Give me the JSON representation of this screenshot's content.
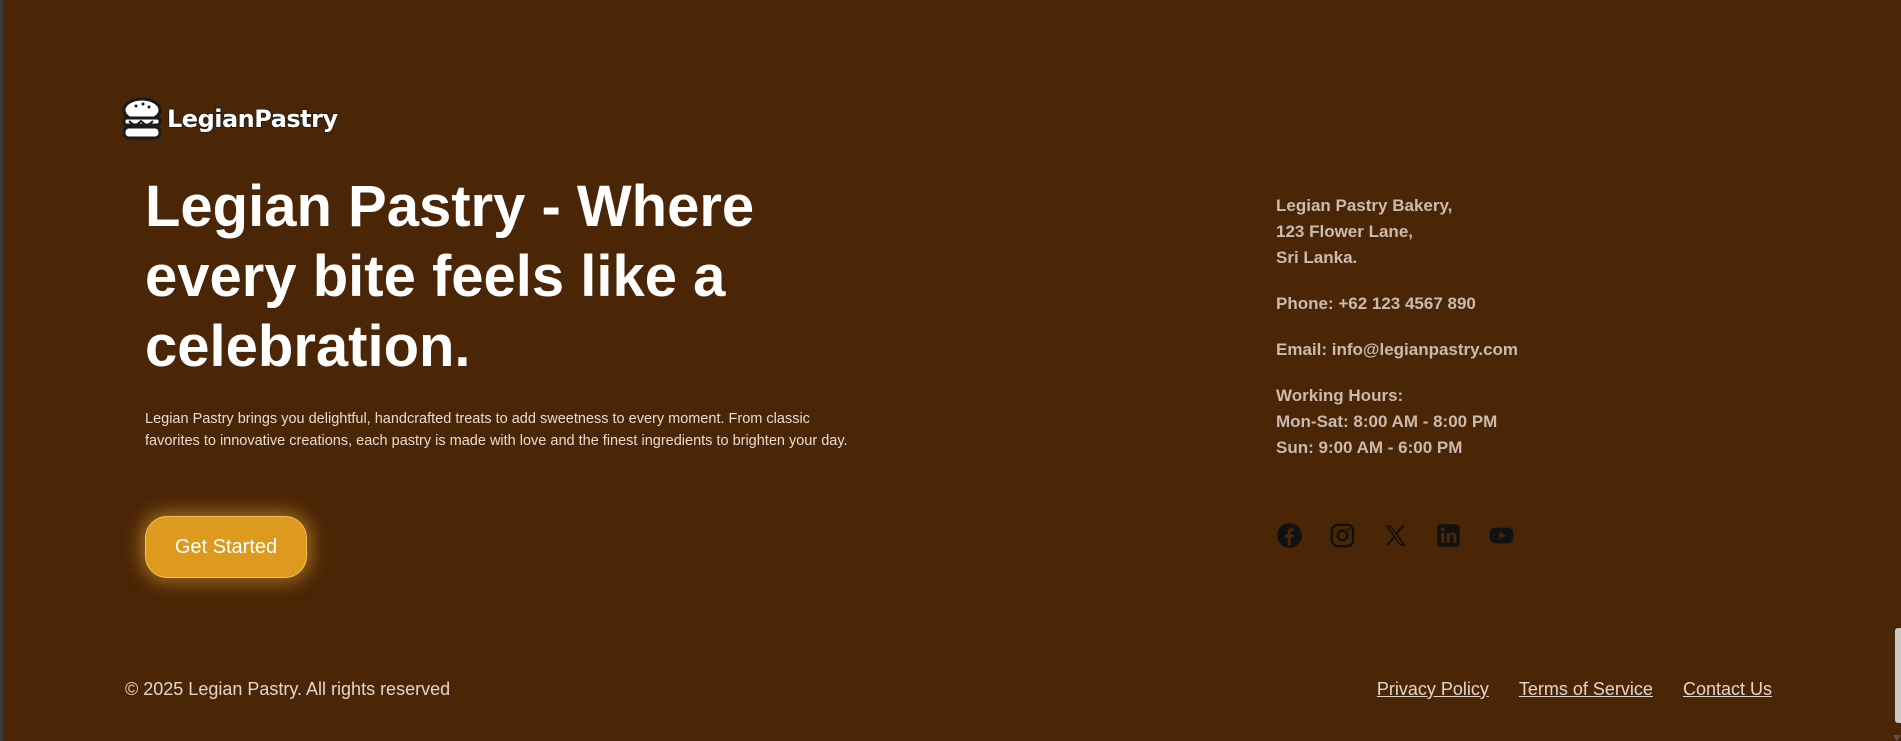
{
  "brand": {
    "logo_text": "LegianPastry"
  },
  "hero": {
    "headline": "Legian Pastry - Where every bite feels like a celebration.",
    "description": "Legian Pastry brings you delightful, handcrafted treats to add sweetness to every moment. From classic favorites to innovative creations, each pastry is made with love and the finest ingredients to brighten your day.",
    "cta_label": "Get Started"
  },
  "contact": {
    "address_line1": "Legian Pastry Bakery,",
    "address_line2": "123 Flower Lane,",
    "address_line3": "Sri Lanka.",
    "phone": "Phone: +62 123 4567 890",
    "email": "Email: info@legianpastry.com",
    "hours_title": "Working Hours:",
    "hours_weekdays": "Mon-Sat: 8:00 AM - 8:00 PM",
    "hours_sunday": "Sun: 9:00 AM - 6:00 PM"
  },
  "socials": [
    {
      "icon": "facebook-icon"
    },
    {
      "icon": "instagram-icon"
    },
    {
      "icon": "x-icon"
    },
    {
      "icon": "linkedin-icon"
    },
    {
      "icon": "youtube-icon"
    }
  ],
  "footer": {
    "copyright": "© 2025 Legian Pastry. All rights reserved",
    "links": [
      "Privacy Policy",
      "Terms of Service",
      "Contact Us"
    ]
  },
  "colors": {
    "background": "#4a2506",
    "accent": "#de9a1e",
    "text_primary": "#ffffff",
    "text_muted": "#c9bbb0"
  }
}
